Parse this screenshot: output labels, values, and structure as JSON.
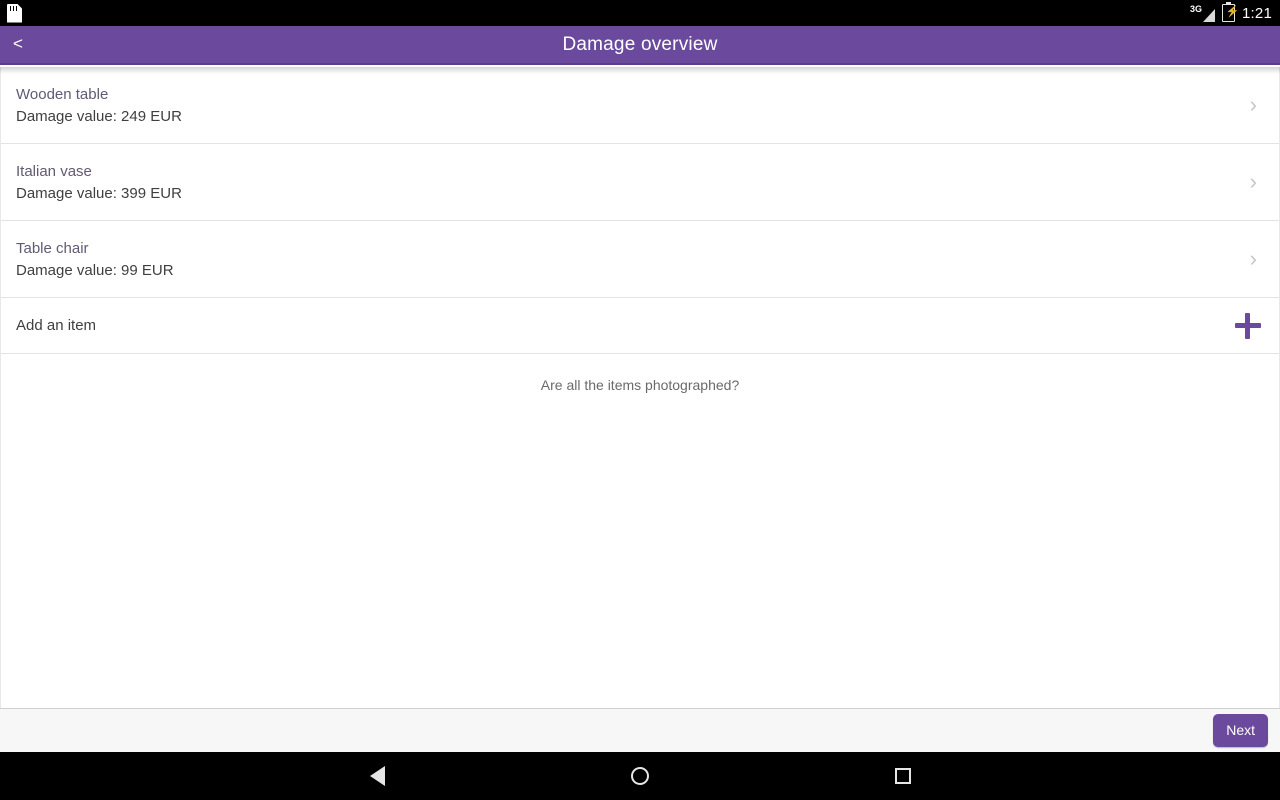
{
  "status_bar": {
    "sd_icon": "sd-card-icon",
    "network_label": "3G",
    "signal_icon": "signal-bars-icon",
    "battery_icon": "battery-charging-icon",
    "time": "1:21"
  },
  "app_bar": {
    "back_label": "<",
    "back_icon": "back-chevron-icon",
    "title": "Damage overview",
    "background_color": "#6b4a9e"
  },
  "list": {
    "items": [
      {
        "title": "Wooden table",
        "subtitle": "Damage value: 249 EUR",
        "chevron": "›"
      },
      {
        "title": "Italian vase",
        "subtitle": "Damage value: 399 EUR",
        "chevron": "›"
      },
      {
        "title": "Table chair",
        "subtitle": "Damage value: 99 EUR",
        "chevron": "›"
      }
    ],
    "add_item": {
      "label": "Add an item",
      "icon": "plus-icon"
    }
  },
  "main": {
    "question": "Are all the items photographed?"
  },
  "footer": {
    "next_label": "Next",
    "accent_color": "#6b4a9e"
  },
  "nav_bar": {
    "back": "nav-back-icon",
    "home": "nav-home-icon",
    "recents": "nav-recents-icon"
  }
}
